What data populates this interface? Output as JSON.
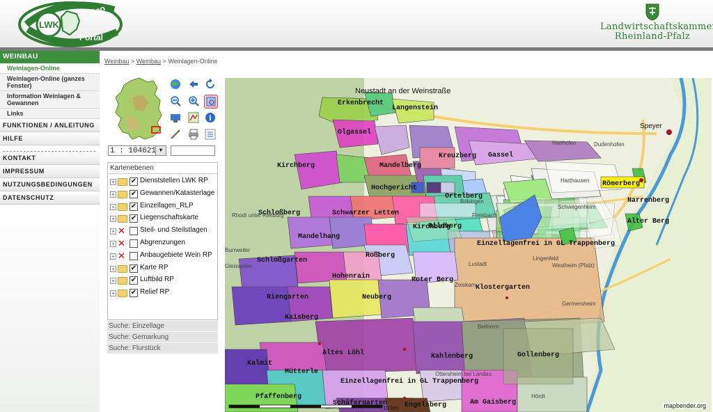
{
  "header": {
    "logo_left": {
      "text1": "LWK",
      "text2": "Geo",
      "text3": "Portal"
    },
    "logo_right": {
      "line1": "Landwirtschaftskammer",
      "line2": "Rheinland-Pfalz"
    }
  },
  "sidebar": {
    "section": "WEINBAU",
    "sub_items": [
      {
        "label": "Weinlagen-Online",
        "current": true
      },
      {
        "label": "Weinlagen-Online (ganzes Fenster)"
      },
      {
        "label": "Information Weinlagen & Gewannen"
      },
      {
        "label": "Links"
      }
    ],
    "nav_group1": [
      "FUNKTIONEN / ANLEITUNG",
      "HILFE"
    ],
    "nav_group2": [
      "KONTAKT",
      "IMPRESSUM",
      "NUTZUNGSBEDINGUNGEN",
      "DATENSCHUTZ"
    ]
  },
  "breadcrumb": {
    "items": [
      "Weinbau",
      "Weinbau"
    ],
    "current": "Weinlagen-Online",
    "sep": ">"
  },
  "controls": {
    "scale_value": "1 : 104621",
    "tools": [
      "globe-icon",
      "back-arrow-icon",
      "refresh-icon",
      "zoom-out-icon",
      "zoom-in-icon",
      "zoom-box-icon",
      "pan-icon",
      "map-legend-icon",
      "info-icon",
      "measure-icon",
      "print-icon",
      "list-icon"
    ]
  },
  "layers": {
    "title": "Kartenebenen",
    "items": [
      {
        "label": "Dienststellen LWK RP",
        "checked": true
      },
      {
        "label": "Gewannen/Katasterlage",
        "checked": true
      },
      {
        "label": "Einzellagen_RLP",
        "checked": true
      },
      {
        "label": "Liegenschaftskarte",
        "checked": true
      },
      {
        "label": "Steil- und Steilstlagen",
        "checked": false,
        "disabled": true
      },
      {
        "label": "Abgrenzungen",
        "checked": false,
        "disabled": true
      },
      {
        "label": "Anbaugebiete Wein RP",
        "checked": false,
        "disabled": true
      },
      {
        "label": "Karte RP",
        "checked": true
      },
      {
        "label": "Luftbild RP",
        "checked": true
      },
      {
        "label": "Relief RP",
        "checked": true
      }
    ]
  },
  "search": [
    "Suche: Einzellage",
    "Suche: Gemarkung",
    "Suche: Flurstück"
  ],
  "map": {
    "credit": "mapbender.org",
    "scalebar": "10 km",
    "labels": [
      "Neustadt an der Weinstraße",
      "Erkenbrecht",
      "Langenstein",
      "Olgassel",
      "Kreuzberg",
      "Gassel",
      "Kirchberg",
      "Mandelberg",
      "Hochgericht",
      "Ortelberg",
      "Schloßberg",
      "Schwarzer Letten",
      "Kirchberg",
      "Bildberg",
      "Mandelhang",
      "Roßberg",
      "Einzellagenfrei in GL Trappenberg",
      "Schloßgarten",
      "Hohenrain",
      "Roter Berg",
      "Klostergarten",
      "Riengarten",
      "Neuberg",
      "Kaisberg",
      "Altes Löhl",
      "Kahlenberg",
      "Gollenberg",
      "Kalmit",
      "Mütterle",
      "Einzellagenfrei in GL Trappenberg",
      "Pfaffenberg",
      "Schäfergarten",
      "Engelsberg",
      "Am Gaisberg",
      "Römerberg",
      "Narrenberg",
      "Alter Berg",
      "Speyer",
      "Dudenhofen",
      "Hanhofen",
      "Harthausen",
      "Schwegenheim",
      "Lingenfeld",
      "Westheim (Pfalz)",
      "Germersheim",
      "Lustadt",
      "Zeiskam",
      "Bellheim",
      "Rhodt unter Rietburg",
      "Burrweiler",
      "Gleisweiler",
      "Freisbach",
      "Böbingen",
      "Ottersheim bei Landau",
      "Hördt"
    ]
  }
}
